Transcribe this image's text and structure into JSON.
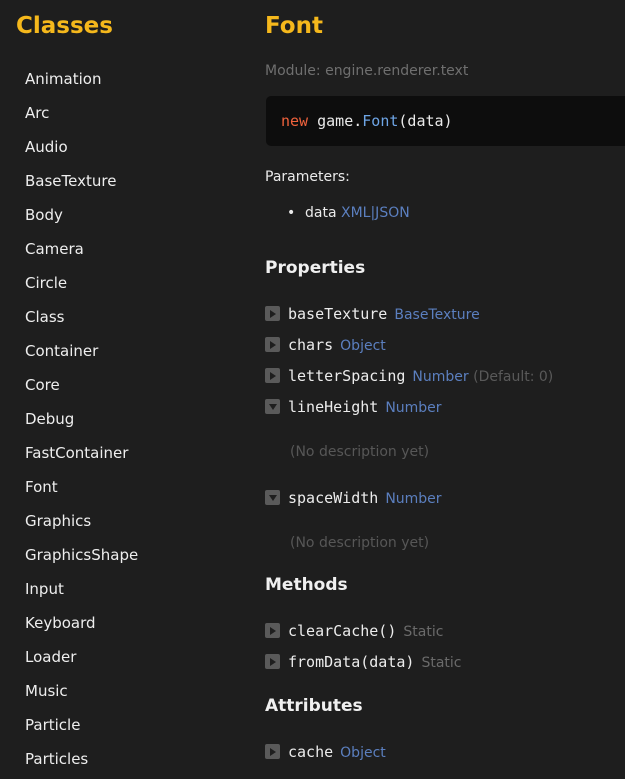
{
  "sidebar": {
    "title": "Classes",
    "items": [
      "Animation",
      "Arc",
      "Audio",
      "BaseTexture",
      "Body",
      "Camera",
      "Circle",
      "Class",
      "Container",
      "Core",
      "Debug",
      "FastContainer",
      "Font",
      "Graphics",
      "GraphicsShape",
      "Input",
      "Keyboard",
      "Loader",
      "Music",
      "Particle",
      "Particles"
    ]
  },
  "main": {
    "title": "Font",
    "module": "Module: engine.renderer.text",
    "code": {
      "keyword": "new",
      "object": "game.",
      "function": "Font",
      "args": "(data)"
    },
    "parameters_label": "Parameters:",
    "parameters": [
      {
        "name": "data",
        "type": "XML|JSON"
      }
    ],
    "properties_heading": "Properties",
    "properties": [
      {
        "name": "baseTexture",
        "type": "BaseTexture",
        "default": "",
        "expanded": false,
        "description": ""
      },
      {
        "name": "chars",
        "type": "Object",
        "default": "",
        "expanded": false,
        "description": ""
      },
      {
        "name": "letterSpacing",
        "type": "Number",
        "default": "(Default: 0)",
        "expanded": false,
        "description": ""
      },
      {
        "name": "lineHeight",
        "type": "Number",
        "default": "",
        "expanded": true,
        "description": "(No description yet)"
      },
      {
        "name": "spaceWidth",
        "type": "Number",
        "default": "",
        "expanded": true,
        "description": "(No description yet)"
      }
    ],
    "methods_heading": "Methods",
    "methods": [
      {
        "name": "clearCache()",
        "tag": "Static"
      },
      {
        "name": "fromData(data)",
        "tag": "Static"
      }
    ],
    "attributes_heading": "Attributes",
    "attributes": [
      {
        "name": "cache",
        "type": "Object"
      }
    ]
  },
  "colors": {
    "accent": "#f5b81c",
    "type": "#5b7fbf",
    "keyword": "#f0623c",
    "function": "#6ea5e6",
    "background": "#1e1e1e",
    "code_bg": "#0d0d0d"
  },
  "icons": {
    "collapsed": "triangle-right-icon",
    "expanded": "triangle-down-icon"
  }
}
